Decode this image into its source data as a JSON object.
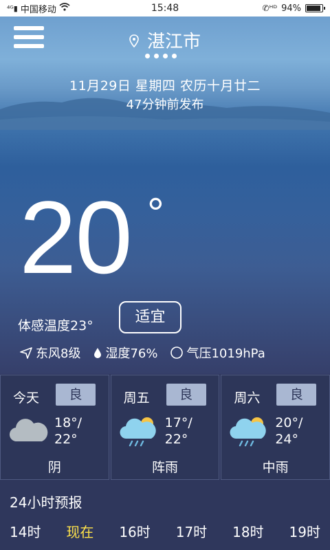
{
  "status_bar": {
    "carrier": "中国移动",
    "time": "15:48",
    "battery": "94%",
    "battery_level": 0.94
  },
  "header": {
    "city": "湛江市",
    "date_line": "11月29日 星期四 农历十月廿二",
    "published": "47分钟前发布"
  },
  "current": {
    "temperature": "20",
    "degree_symbol": "°",
    "feels_like": "体感温度23°",
    "comfort": "适宜",
    "wind": "东风8级",
    "humidity": "湿度76%",
    "pressure": "气压1019hPa"
  },
  "forecast": [
    {
      "day": "今天",
      "aqi": "良",
      "high": "18°/",
      "low": "22°",
      "desc": "阴",
      "icon": "cloudy-icon"
    },
    {
      "day": "周五",
      "aqi": "良",
      "high": "17°/",
      "low": "22°",
      "desc": "阵雨",
      "icon": "shower-icon"
    },
    {
      "day": "周六",
      "aqi": "良",
      "high": "20°/",
      "low": "24°",
      "desc": "中雨",
      "icon": "moderate-rain-icon"
    }
  ],
  "hourly": {
    "title": "24小时预报",
    "hours": [
      "14时",
      "现在",
      "16时",
      "17时",
      "18时",
      "19时"
    ]
  },
  "colors": {
    "accent_now": "#ffe34a",
    "panel_bg": "#2f375c"
  }
}
